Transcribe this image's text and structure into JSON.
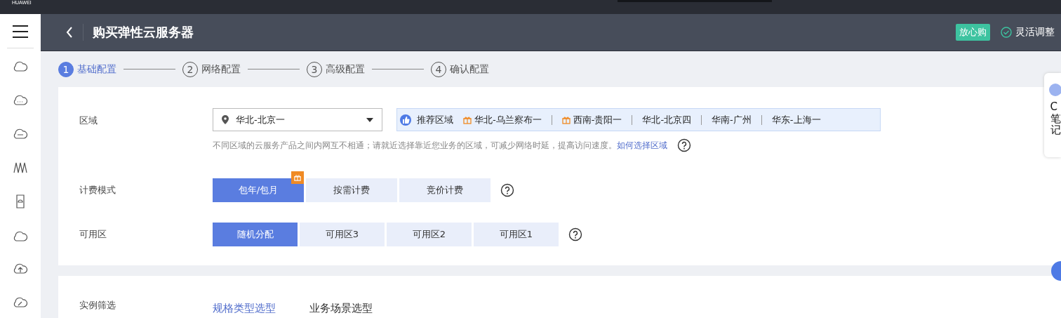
{
  "top_bar": {
    "brand": "HUAWEI"
  },
  "header": {
    "title": "购买弹性云服务器",
    "badge": "放心购",
    "feature": "灵活调整"
  },
  "steps": [
    {
      "number": "1",
      "label": "基础配置",
      "selected": true
    },
    {
      "number": "2",
      "label": "网络配置",
      "selected": false
    },
    {
      "number": "3",
      "label": "高级配置",
      "selected": false
    },
    {
      "number": "4",
      "label": "确认配置",
      "selected": false
    }
  ],
  "region": {
    "label": "区域",
    "value": "华北-北京一",
    "recommend_label": "推荐区域",
    "recommended": [
      {
        "name": "华北-乌兰察布一",
        "gift": true
      },
      {
        "name": "西南-贵阳一",
        "gift": true
      },
      {
        "name": "华北-北京四",
        "gift": false
      },
      {
        "name": "华南-广州",
        "gift": false
      },
      {
        "name": "华东-上海一",
        "gift": false
      }
    ],
    "hint": "不同区域的云服务产品之间内网互不相通；请就近选择靠近您业务的区域，可减少网络时延，提高访问速度。",
    "hint_link": "如何选择区域"
  },
  "billing": {
    "label": "计费模式",
    "options": [
      {
        "label": "包年/包月",
        "selected": true,
        "gift": true
      },
      {
        "label": "按需计费",
        "selected": false,
        "gift": false
      },
      {
        "label": "竞价计费",
        "selected": false,
        "gift": false
      }
    ]
  },
  "availability_zone": {
    "label": "可用区",
    "options": [
      {
        "label": "随机分配",
        "selected": true
      },
      {
        "label": "可用区3",
        "selected": false
      },
      {
        "label": "可用区2",
        "selected": false
      },
      {
        "label": "可用区1",
        "selected": false
      }
    ]
  },
  "instance_filter": {
    "label": "实例筛选",
    "tabs": [
      {
        "label": "规格类型选型",
        "selected": true
      },
      {
        "label": "业务场景选型",
        "selected": false
      }
    ]
  },
  "side_widget": {
    "text": "C笔记"
  }
}
